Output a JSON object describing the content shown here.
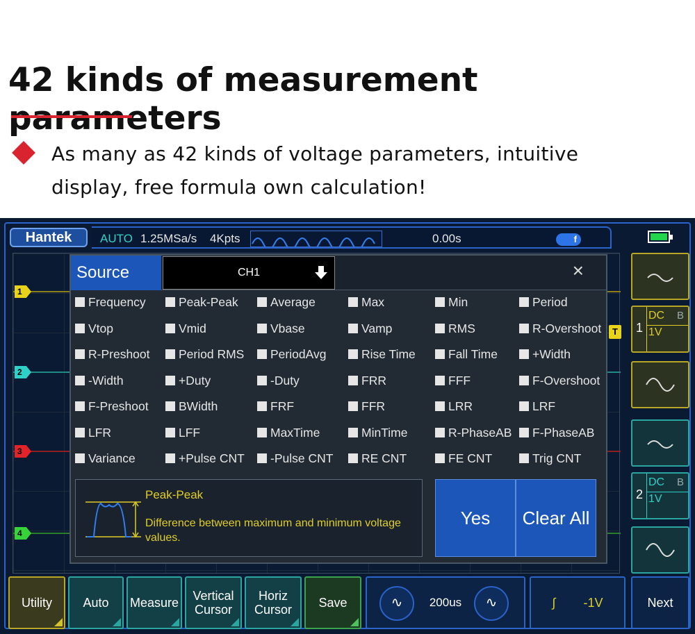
{
  "headline": "42 kinds of measurement parameters",
  "bullet": {
    "line1": "As many as 42 kinds of voltage parameters, intuitive",
    "line2": "display, free formula own calculation!"
  },
  "topbar": {
    "brand": "Hantek",
    "mode": "AUTO",
    "sample_rate": "1.25MSa/s",
    "memory_depth": "4Kpts",
    "time_offset": "0.00s",
    "trigger_badge": "f"
  },
  "channels": [
    {
      "label": "1",
      "color": "#e8d21a"
    },
    {
      "label": "2",
      "color": "#2fd0c8"
    },
    {
      "label": "3",
      "color": "#e0242a"
    },
    {
      "label": "4",
      "color": "#38d23a"
    }
  ],
  "trigger_marker": "T",
  "side_panel": {
    "ch1": {
      "num": "1",
      "coupling": "DC",
      "bw": "B",
      "volts": "1V"
    },
    "ch2": {
      "num": "2",
      "coupling": "DC",
      "bw": "B",
      "volts": "1V"
    }
  },
  "dialog": {
    "source_label": "Source",
    "source_value": "CH1",
    "close": "×",
    "params": [
      [
        "Frequency",
        "Peak-Peak",
        "Average",
        "Max",
        "Min",
        "Period"
      ],
      [
        "Vtop",
        "Vmid",
        "Vbase",
        "Vamp",
        "RMS",
        "R-Overshoot"
      ],
      [
        "R-Preshoot",
        "Period RMS",
        "PeriodAvg",
        "Rise Time",
        "Fall Time",
        "+Width"
      ],
      [
        "-Width",
        "+Duty",
        "-Duty",
        "FRR",
        "FFF",
        "F-Overshoot"
      ],
      [
        "F-Preshoot",
        "BWidth",
        "FRF",
        "FFR",
        "LRR",
        "LRF"
      ],
      [
        "LFR",
        "LFF",
        "MaxTime",
        "MinTime",
        "R-PhaseAB",
        "F-PhaseAB"
      ],
      [
        "Variance",
        "+Pulse CNT",
        "-Pulse CNT",
        "RE CNT",
        "FE CNT",
        "Trig CNT"
      ]
    ],
    "info_title": "Peak-Peak",
    "info_desc": "Difference between maximum and minimum voltage values.",
    "yes": "Yes",
    "clear_all": "Clear All"
  },
  "bottom_bar": {
    "utility": "Utility",
    "auto": "Auto",
    "measure": "Measure",
    "vertical_cursor": "Vertical Cursor",
    "horiz_cursor": "Horiz Cursor",
    "save": "Save",
    "timebase": "200us",
    "knob_left": "∿",
    "knob_right": "∿",
    "trigger_level_icon": "∫",
    "trigger_level": "-1V",
    "next": "Next"
  }
}
